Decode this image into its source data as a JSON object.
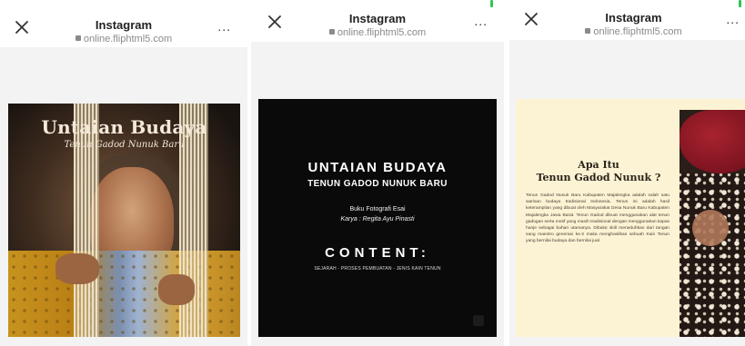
{
  "panels": [
    {
      "header": {
        "title": "Instagram",
        "url": "online.fliphtml5.com",
        "close_icon": "close-icon",
        "more_label": "..."
      },
      "page": {
        "title": "Untaian Budaya",
        "subtitle": "Tenun Gadod Nunuk Baru"
      }
    },
    {
      "header": {
        "title": "Instagram",
        "url": "online.fliphtml5.com",
        "close_icon": "close-icon",
        "more_label": "..."
      },
      "page": {
        "title": "UNTAIAN BUDAYA",
        "subtitle": "TENUN GADOD NUNUK BARU",
        "book_type": "Buku Fotografi Esai",
        "author": "Karya : Regita Ayu Pinasti",
        "content_heading": "CONTENT:",
        "contents_list": "SEJARAH - PROSES PEMBUATAN - JENIS KAIN TENUN"
      }
    },
    {
      "header": {
        "title": "Instagram",
        "url": "online.fliphtml5.com",
        "close_icon": "close-icon",
        "more_label": "..."
      },
      "page": {
        "heading_line1": "Apa Itu",
        "heading_line2": "Tenun Gadod Nunuk ?",
        "body": "Tenun Gadod Nunuk Baru Kabupaten Majalengka adalah salah satu warisan budaya tradisional Indonesia. Tenun ini adalah hasil keterampilan yang dibuat oleh Masyarakat Desa Nunuk Baru Kabupaten Majalengka Jawa Barat. Tenun Gadod dibuat menggunakan alat tenun gadogan serta motif yang masih tradisional dengan menggunakan kapas hanje sebagai bahan utamanya. Dibalut skill meneduhkan dari tangan sang maestro generasi ke-2 maka menghasilkan sebuah Kain Tenun yang bernilai budaya dan bernilai jual."
      }
    }
  ],
  "colors": {
    "status_indicator": "#2dc653",
    "page_bg": "#f3f3f3",
    "cover2_bg": "#0a0a0a",
    "cover3_bg": "#fbf3d4"
  }
}
